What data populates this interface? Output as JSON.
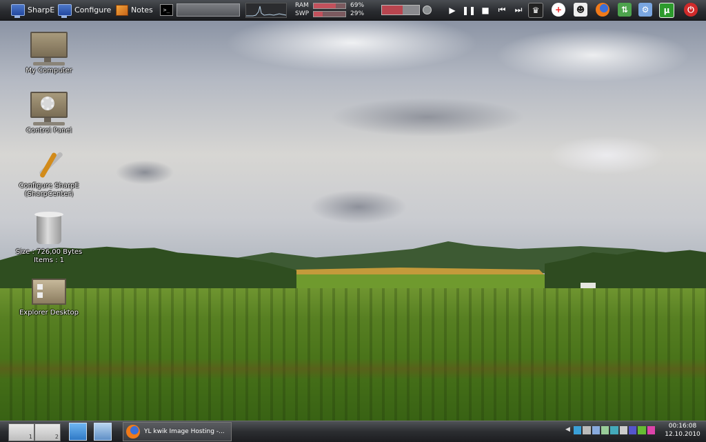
{
  "topbar": {
    "sharpe_label": "SharpE",
    "configure_label": "Configure",
    "notes_label": "Notes",
    "terminal_glyph": ">_",
    "ram_label": "RAM",
    "ram_percent": 69,
    "ram_text": "69%",
    "swp_label": "SWP",
    "swp_percent": 29,
    "swp_text": "29%",
    "volume_level": 0.55
  },
  "desktop": {
    "icons": [
      {
        "label": "My Computer"
      },
      {
        "label": "Control Panel"
      },
      {
        "label": "Configure SharpE (SharpCenter)"
      },
      {
        "label_line1": "Size : 726,00 Bytes",
        "label_line2": "Items : 1"
      },
      {
        "label": "Explorer Desktop"
      }
    ]
  },
  "taskbar": {
    "pagers": [
      "1",
      "2"
    ],
    "task_title": "YL kwik Image Hosting -...",
    "clock_time": "00:16:08",
    "clock_date": "12.10.2010"
  },
  "colors": {
    "meter_fill": "#c2515c",
    "bar_top": "#4a4d52",
    "bar_bottom": "#1c1d20"
  }
}
